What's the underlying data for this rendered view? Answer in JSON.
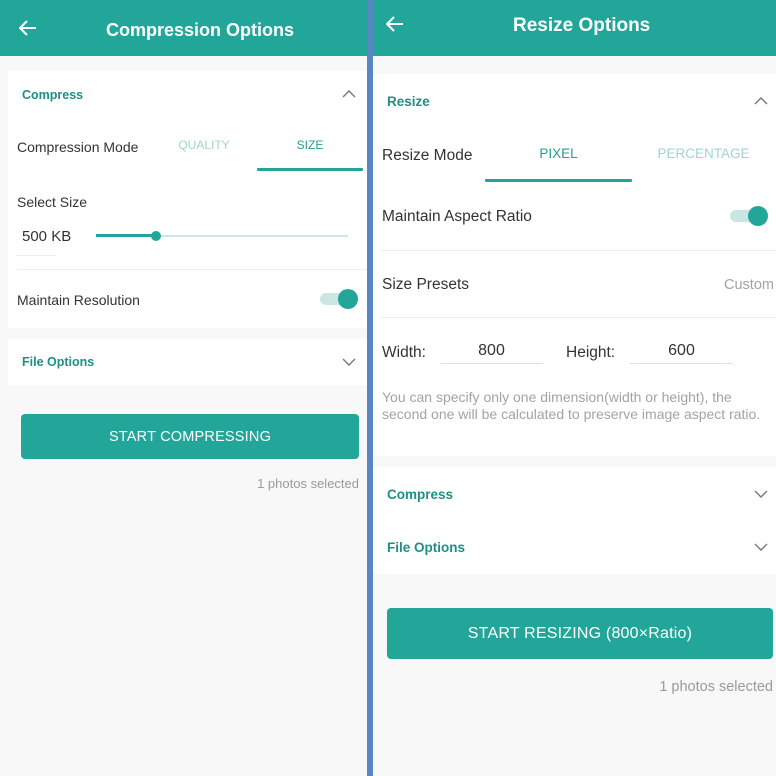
{
  "colors": {
    "accent": "#22a699",
    "accent_text": "#1f8f84",
    "divider": "#5b86c4"
  },
  "compression": {
    "title": "Compression Options",
    "back_icon": "arrow-left-icon",
    "compress_section": {
      "title": "Compress",
      "expanded": true,
      "mode_label": "Compression Mode",
      "tabs": [
        {
          "label": "QUALITY",
          "active": false
        },
        {
          "label": "SIZE",
          "active": true
        }
      ],
      "select_size_label": "Select Size",
      "size_value": "500 KB",
      "size_slider_fraction": 0.24,
      "maintain_resolution_label": "Maintain Resolution",
      "maintain_resolution_on": true
    },
    "file_options": {
      "title": "File Options",
      "expanded": false
    },
    "start_button": "START COMPRESSING",
    "status": "1 photos selected"
  },
  "resize": {
    "title": "Resize Options",
    "back_icon": "arrow-left-icon",
    "resize_section": {
      "title": "Resize",
      "expanded": true,
      "mode_label": "Resize Mode",
      "tabs": [
        {
          "label": "PIXEL",
          "active": true
        },
        {
          "label": "PERCENTAGE",
          "active": false
        }
      ],
      "aspect_label": "Maintain Aspect Ratio",
      "aspect_on": true,
      "presets_label": "Size Presets",
      "presets_value": "Custom",
      "width_label": "Width:",
      "width_value": "800",
      "height_label": "Height:",
      "height_value": "600",
      "hint": "You can specify only one dimension(width or height), the second one will be calculated to preserve image aspect ratio."
    },
    "compress_section": {
      "title": "Compress",
      "expanded": false
    },
    "file_options": {
      "title": "File Options",
      "expanded": false
    },
    "start_button": "START RESIZING (800×Ratio)",
    "status": "1 photos selected"
  }
}
